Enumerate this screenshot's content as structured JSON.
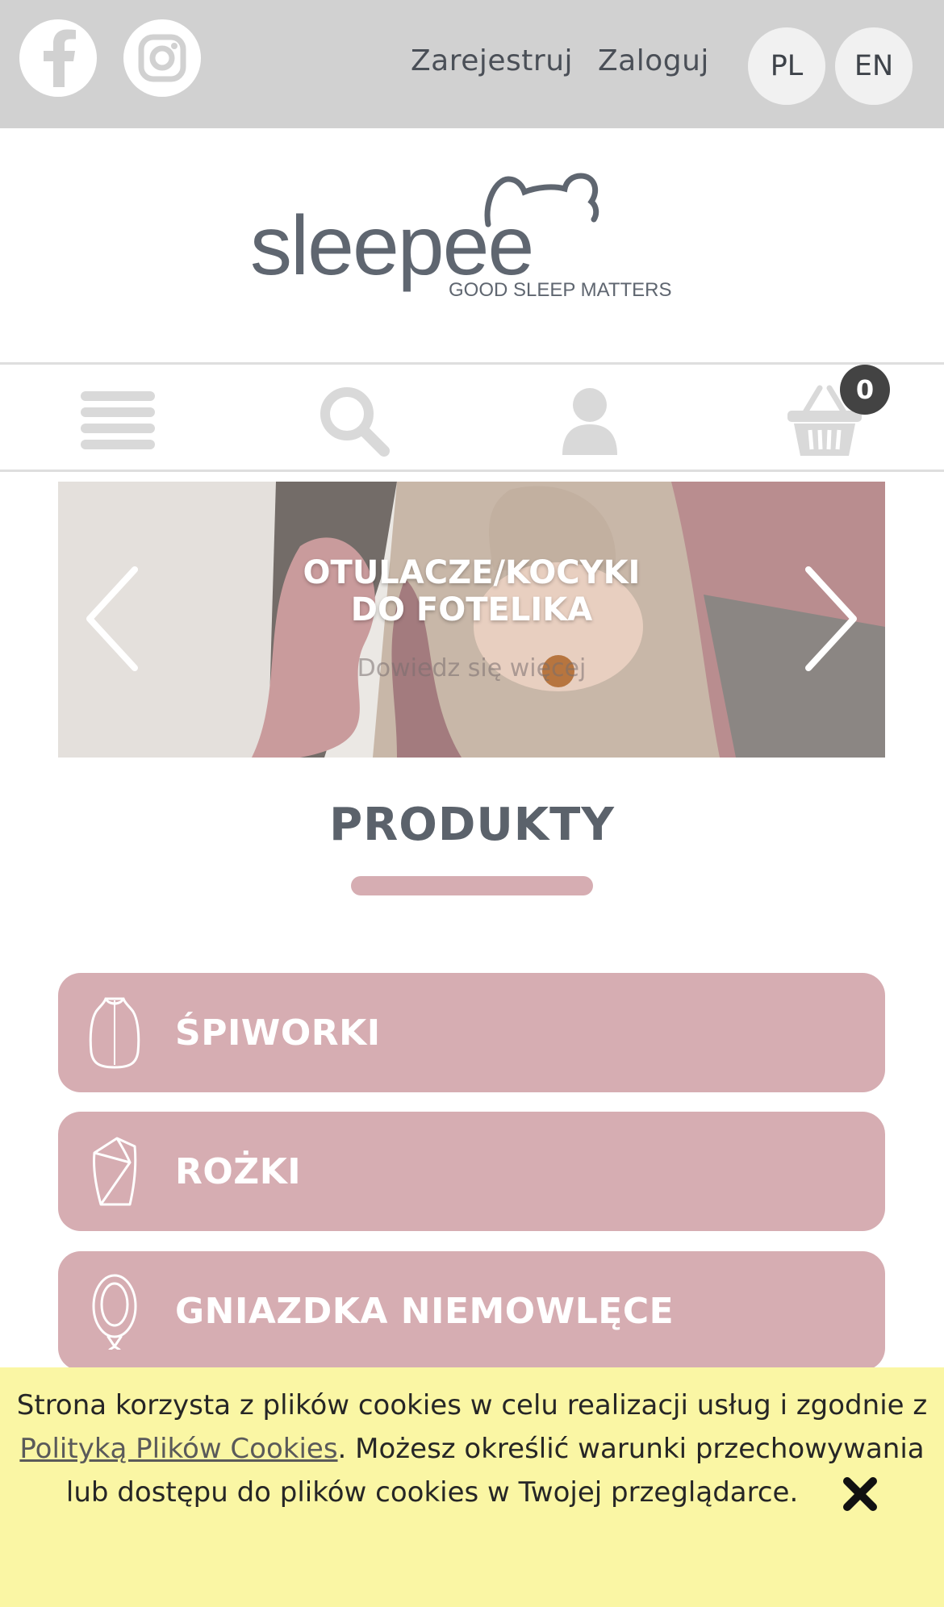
{
  "topbar": {
    "social": [
      "facebook-icon",
      "instagram-icon"
    ],
    "register_label": "Zarejestruj",
    "login_label": "Zaloguj",
    "languages": [
      "PL",
      "EN"
    ]
  },
  "logo": {
    "name": "sleepee",
    "tagline": "GOOD SLEEP MATTERS"
  },
  "iconbar": {
    "icons": [
      "menu-icon",
      "search-icon",
      "user-icon",
      "basket-icon"
    ],
    "cart_count": "0"
  },
  "slider": {
    "title_line1": "OTULACZE/KOCYKI",
    "title_line2": "DO FOTELIKA",
    "subtitle": "Dowiedz się więcej"
  },
  "products": {
    "title": "PRODUKTY",
    "categories": [
      {
        "label": "ŚPIWORKI",
        "icon": "sleeping-bag-icon"
      },
      {
        "label": "ROŻKI",
        "icon": "swaddle-icon"
      },
      {
        "label": "GNIAZDKA NIEMOWLĘCE",
        "icon": "baby-nest-icon"
      }
    ]
  },
  "cookie": {
    "text_before": "Strona korzysta z plików cookies w celu realizacji usług i zgodnie z ",
    "link_text": "Polityką Plików Cookies",
    "text_after": ". Możesz określić warunki przechowywania lub dostępu do plików cookies w Twojej przeglądarce."
  },
  "colors": {
    "topbar_bg": "#d1d1d1",
    "accent_pink": "#d6adb2",
    "cookie_bg": "#faf6a4",
    "text_gray": "#5f6670"
  }
}
